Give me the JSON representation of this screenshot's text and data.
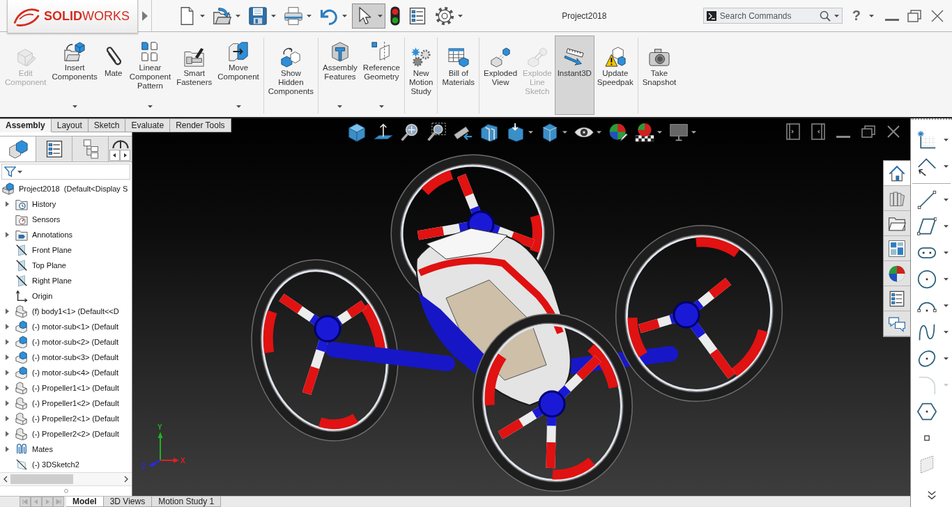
{
  "window": {
    "title": "Project2018"
  },
  "brand": {
    "name": "**SOLID**WORKS"
  },
  "quick_access": [
    {
      "kind": "new",
      "caret": true,
      "selected": false
    },
    {
      "kind": "open",
      "caret": true,
      "selected": false
    },
    {
      "kind": "save",
      "caret": true,
      "selected": false
    },
    {
      "kind": "print",
      "caret": true,
      "selected": false
    },
    {
      "kind": "undo",
      "caret": true,
      "selected": false
    },
    {
      "kind": "select",
      "caret": true,
      "selected": true
    },
    {
      "kind": "rebuild",
      "caret": false,
      "selected": false
    },
    {
      "kind": "file-properties",
      "caret": false,
      "selected": false
    },
    {
      "kind": "options",
      "caret": true,
      "selected": false
    }
  ],
  "search": {
    "placeholder": "Search Commands"
  },
  "help": {
    "label": "?"
  },
  "ribbon": {
    "groups": [
      {
        "buttons": [
          {
            "label": "Edit\nComponent",
            "kind": "edit-component",
            "caret": false,
            "disabled": true,
            "on": false
          },
          {
            "label": "Insert\nComponents",
            "kind": "insert-components",
            "caret": true,
            "disabled": false,
            "on": false
          },
          {
            "label": "Mate",
            "kind": "mate",
            "caret": false,
            "disabled": false,
            "on": false
          },
          {
            "label": "Linear\nComponent\nPattern",
            "kind": "linear-pattern",
            "caret": true,
            "disabled": false,
            "on": false
          },
          {
            "label": "Smart\nFasteners",
            "kind": "smart-fasteners",
            "caret": false,
            "disabled": false,
            "on": false
          },
          {
            "label": "Move\nComponent",
            "kind": "move-component",
            "caret": true,
            "disabled": false,
            "on": false
          }
        ]
      },
      {
        "buttons": [
          {
            "label": "Show\nHidden\nComponents",
            "kind": "show-hidden",
            "caret": false,
            "disabled": false,
            "on": false
          }
        ]
      },
      {
        "buttons": [
          {
            "label": "Assembly\nFeatures",
            "kind": "assembly-features",
            "caret": true,
            "disabled": false,
            "on": false
          },
          {
            "label": "Reference\nGeometry",
            "kind": "reference-geometry",
            "caret": true,
            "disabled": false,
            "on": false
          }
        ]
      },
      {
        "buttons": [
          {
            "label": "New\nMotion\nStudy",
            "kind": "motion-study",
            "caret": false,
            "disabled": false,
            "on": false
          }
        ]
      },
      {
        "buttons": [
          {
            "label": "Bill of\nMaterials",
            "kind": "bom",
            "caret": false,
            "disabled": false,
            "on": false
          }
        ]
      },
      {
        "buttons": [
          {
            "label": "Exploded\nView",
            "kind": "exploded-view",
            "caret": false,
            "disabled": false,
            "on": false
          },
          {
            "label": "Explode\nLine\nSketch",
            "kind": "explode-line-sketch",
            "caret": false,
            "disabled": true,
            "on": false
          },
          {
            "label": "Instant3D",
            "kind": "instant3d",
            "caret": false,
            "disabled": false,
            "on": true
          },
          {
            "label": "Update\nSpeedpak",
            "kind": "speedpak",
            "caret": false,
            "disabled": false,
            "on": false
          }
        ]
      },
      {
        "buttons": [
          {
            "label": "Take\nSnapshot",
            "kind": "snapshot",
            "caret": false,
            "disabled": false,
            "on": false
          }
        ]
      }
    ]
  },
  "command_tabs": [
    {
      "label": "Assembly",
      "selected": true
    },
    {
      "label": "Layout",
      "selected": false
    },
    {
      "label": "Sketch",
      "selected": false
    },
    {
      "label": "Evaluate",
      "selected": false
    },
    {
      "label": "Render Tools",
      "selected": false
    }
  ],
  "feature_manager": {
    "tabs": [
      {
        "kind": "feature-tree",
        "selected": true
      },
      {
        "kind": "property-manager",
        "selected": false
      },
      {
        "kind": "configuration-manager",
        "selected": false
      },
      {
        "kind": "dimxpert",
        "selected": false
      }
    ],
    "tree": {
      "label": "Project2018  (Default<Display S",
      "kind": "assembly",
      "children": [
        {
          "label": "History",
          "kind": "history",
          "expandable": true
        },
        {
          "label": "Sensors",
          "kind": "sensors",
          "expandable": false
        },
        {
          "label": "Annotations",
          "kind": "annotations",
          "expandable": true
        },
        {
          "label": "Front Plane",
          "kind": "plane",
          "expandable": false
        },
        {
          "label": "Top Plane",
          "kind": "plane",
          "expandable": false
        },
        {
          "label": "Right Plane",
          "kind": "plane",
          "expandable": false
        },
        {
          "label": "Origin",
          "kind": "origin",
          "expandable": false
        },
        {
          "label": "(f) body1<1> (Default<<D",
          "kind": "part",
          "expandable": true
        },
        {
          "label": "(-) motor-sub<1> (Default",
          "kind": "subassembly",
          "expandable": true
        },
        {
          "label": "(-) motor-sub<2> (Default",
          "kind": "subassembly",
          "expandable": true
        },
        {
          "label": "(-) motor-sub<3> (Default",
          "kind": "subassembly",
          "expandable": true
        },
        {
          "label": "(-) motor-sub<4> (Default",
          "kind": "subassembly",
          "expandable": true
        },
        {
          "label": "(-) Propeller1<1> (Default",
          "kind": "part",
          "expandable": true
        },
        {
          "label": "(-) Propeller1<2> (Default",
          "kind": "part",
          "expandable": true
        },
        {
          "label": "(-) Propeller2<1> (Default",
          "kind": "part",
          "expandable": true
        },
        {
          "label": "(-) Propeller2<2> (Default",
          "kind": "part",
          "expandable": true
        },
        {
          "label": "Mates",
          "kind": "mates",
          "expandable": true
        },
        {
          "label": "(-) 3DSketch2",
          "kind": "sketch",
          "expandable": false
        }
      ]
    }
  },
  "viewport": {
    "view_toolbar": [
      {
        "kind": "view-orientation",
        "caret": false
      },
      {
        "kind": "normal-to",
        "caret": false
      },
      {
        "kind": "zoom-fit",
        "caret": false
      },
      {
        "kind": "zoom-area",
        "caret": false
      },
      {
        "kind": "previous-view",
        "caret": false
      },
      {
        "kind": "section-view",
        "caret": false
      },
      {
        "kind": "dynamic-annotation",
        "caret": true
      },
      {
        "kind": "display-style",
        "caret": true
      },
      {
        "kind": "hide-show",
        "caret": true
      },
      {
        "kind": "edit-appearance",
        "caret": false
      },
      {
        "kind": "apply-scene",
        "caret": true
      },
      {
        "kind": "view-settings",
        "caret": true
      }
    ],
    "task_pane": [
      {
        "kind": "home",
        "selected": true
      },
      {
        "kind": "design-library",
        "selected": false
      },
      {
        "kind": "file-explorer",
        "selected": false
      },
      {
        "kind": "view-palette",
        "selected": false
      },
      {
        "kind": "appearances",
        "selected": false
      },
      {
        "kind": "custom-properties",
        "selected": false
      },
      {
        "kind": "forum",
        "selected": false
      }
    ],
    "triad": [
      {
        "label": "Y",
        "color": "#22b022"
      },
      {
        "label": "X",
        "color": "#e02020"
      },
      {
        "label": "Z",
        "color": "#2a2ae0"
      }
    ]
  },
  "sketch_toolbar": {
    "groups": [
      {
        "tools": [
          {
            "kind": "sketch",
            "caret": true,
            "disabled": false
          },
          {
            "kind": "smart-dimension",
            "caret": true,
            "disabled": false
          }
        ]
      },
      {
        "tools": [
          {
            "kind": "line",
            "caret": true,
            "disabled": false
          },
          {
            "kind": "rectangle",
            "caret": true,
            "disabled": false
          },
          {
            "kind": "slot",
            "caret": true,
            "disabled": false
          },
          {
            "kind": "circle",
            "caret": true,
            "disabled": false
          },
          {
            "kind": "arc",
            "caret": true,
            "disabled": false
          },
          {
            "kind": "spline",
            "caret": true,
            "disabled": false
          },
          {
            "kind": "ellipse",
            "caret": true,
            "disabled": false
          },
          {
            "kind": "fillet",
            "caret": true,
            "disabled": true
          },
          {
            "kind": "polygon",
            "caret": false,
            "disabled": false
          },
          {
            "kind": "point",
            "caret": false,
            "disabled": false
          },
          {
            "kind": "sketch-plane",
            "caret": false,
            "disabled": false
          }
        ]
      }
    ]
  },
  "bottom_tabs": [
    {
      "label": "Model",
      "selected": true
    },
    {
      "label": "3D Views",
      "selected": false
    },
    {
      "label": "Motion Study 1",
      "selected": false
    }
  ]
}
